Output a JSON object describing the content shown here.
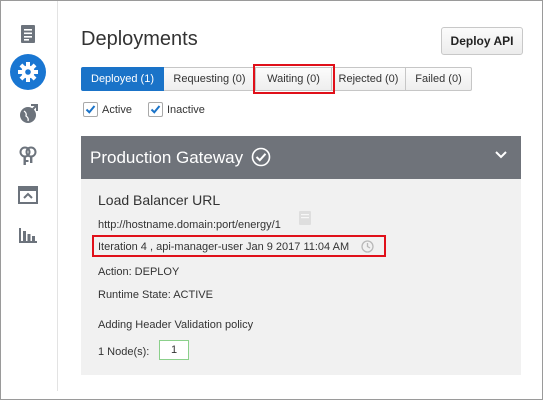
{
  "page": {
    "title": "Deployments",
    "deploy_button": "Deploy API"
  },
  "sidebar": {
    "items": [
      {
        "icon": "document-list-icon",
        "active": false
      },
      {
        "icon": "gear-icon",
        "active": true
      },
      {
        "icon": "globe-arrow-icon",
        "active": false
      },
      {
        "icon": "keys-icon",
        "active": false
      },
      {
        "icon": "portal-window-icon",
        "active": false
      },
      {
        "icon": "analytics-bars-icon",
        "active": false
      }
    ]
  },
  "tabs": [
    {
      "label": "Deployed (1)",
      "selected": true
    },
    {
      "label": "Requesting (0)",
      "selected": false
    },
    {
      "label": "Waiting (0)",
      "selected": false,
      "highlighted": true
    },
    {
      "label": "Rejected (0)",
      "selected": false
    },
    {
      "label": "Failed (0)",
      "selected": false
    }
  ],
  "filters": {
    "active_label": "Active",
    "active_checked": true,
    "inactive_label": "Inactive",
    "inactive_checked": true
  },
  "gateway": {
    "name": "Production Gateway",
    "load_balancer_title": "Load Balancer URL",
    "url": "http://hostname.domain:port/energy/1",
    "iteration": "Iteration 4 , api-manager-user  Jan 9 2017 11:04 AM",
    "action": "Action: DEPLOY",
    "runtime_state": "Runtime State: ACTIVE",
    "policy_message": "Adding Header Validation policy",
    "nodes_label": "1 Node(s):",
    "nodes_value": "1"
  },
  "colors": {
    "accent": "#1a73c8",
    "panel_header": "#6f737a",
    "panel_body": "#f1f1f1",
    "highlight": "#e0101a"
  }
}
